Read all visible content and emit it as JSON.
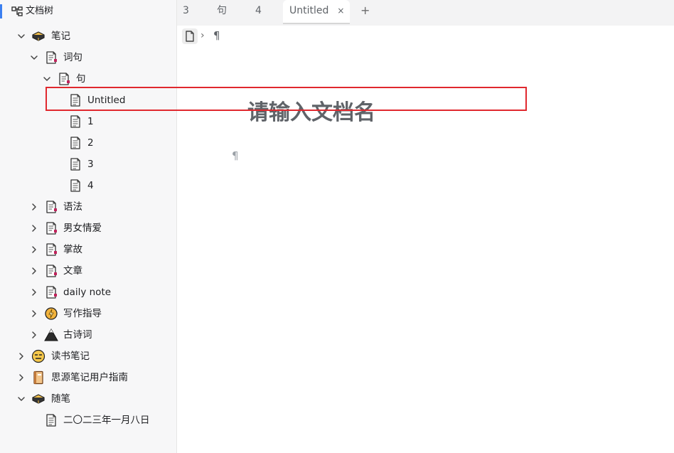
{
  "sidebar": {
    "title": "文档树",
    "items": [
      {
        "label": "笔记",
        "icon": "stack-of-books-icon",
        "arrow": "down"
      },
      {
        "label": "词句",
        "icon": "document-icon",
        "arrow": "down"
      },
      {
        "label": "句",
        "icon": "document-icon",
        "arrow": "down"
      },
      {
        "label": "Untitled",
        "icon": "plain-document-icon",
        "arrow": "none"
      },
      {
        "label": "1",
        "icon": "plain-document-icon",
        "arrow": "none"
      },
      {
        "label": "2",
        "icon": "plain-document-icon",
        "arrow": "none"
      },
      {
        "label": "3",
        "icon": "plain-document-icon",
        "arrow": "none"
      },
      {
        "label": "4",
        "icon": "plain-document-icon",
        "arrow": "none"
      },
      {
        "label": "语法",
        "icon": "document-icon",
        "arrow": "right"
      },
      {
        "label": "男女情爱",
        "icon": "document-icon",
        "arrow": "right"
      },
      {
        "label": "掌故",
        "icon": "document-icon",
        "arrow": "right"
      },
      {
        "label": "文章",
        "icon": "document-icon",
        "arrow": "right"
      },
      {
        "label": "daily note",
        "icon": "document-icon",
        "arrow": "right"
      },
      {
        "label": "写作指导",
        "icon": "lightning-coin-icon",
        "arrow": "right"
      },
      {
        "label": "古诗词",
        "icon": "mountain-icon",
        "arrow": "right"
      },
      {
        "label": "读书笔记",
        "icon": "expressionless-face-icon",
        "arrow": "right"
      },
      {
        "label": "思源笔记用户指南",
        "icon": "notebook-icon",
        "arrow": "right"
      },
      {
        "label": "随笔",
        "icon": "stack-of-books-icon",
        "arrow": "down"
      },
      {
        "label": "二〇二三年一月八日",
        "icon": "plain-document-icon",
        "arrow": "none"
      }
    ]
  },
  "tabs": [
    {
      "label": "3"
    },
    {
      "label": "句"
    },
    {
      "label": "4"
    },
    {
      "label": "Untitled",
      "active": true,
      "close": "×"
    }
  ],
  "new_tab": "+",
  "breadcrumb": {
    "separator": "›",
    "block": "¶"
  },
  "editor": {
    "title_placeholder": "请输入文档名",
    "title_value": "",
    "paragraph_mark": "¶"
  },
  "colors": {
    "accent": "#3b7ff0",
    "highlight_box": "#e0282e",
    "doc_marker": "#c0225b"
  }
}
